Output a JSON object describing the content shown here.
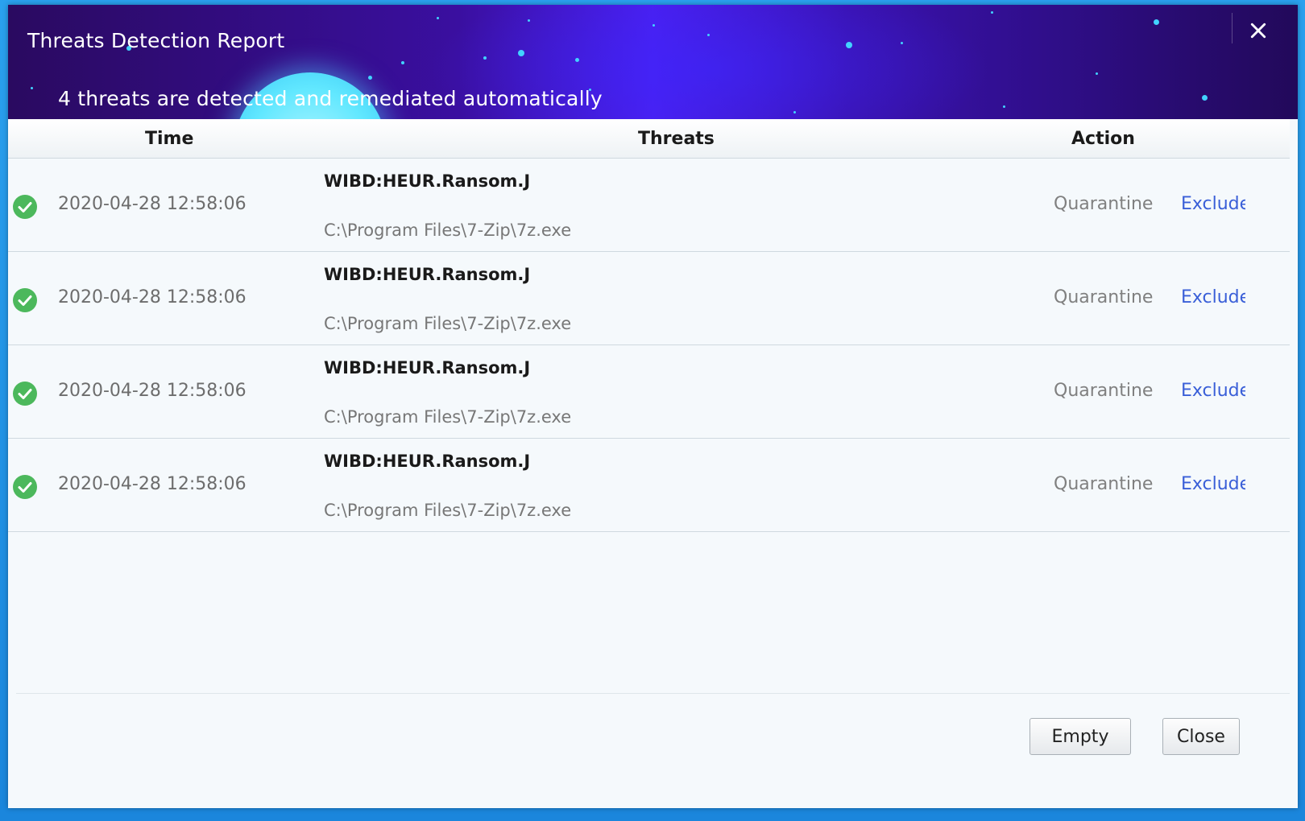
{
  "window": {
    "title": "Threats Detection Report",
    "subtitle": "4 threats are detected and remediated automatically",
    "close_icon": "close-icon"
  },
  "table": {
    "columns": {
      "time": "Time",
      "threats": "Threats",
      "action": "Action"
    },
    "rows": [
      {
        "status_icon": "check-circle-icon",
        "time": "2020-04-28 12:58:06",
        "threat": "WIBD:HEUR.Ransom.J",
        "path": "C:\\Program Files\\7-Zip\\7z.exe",
        "action": "Quarantine",
        "exclude": "Exclude"
      },
      {
        "status_icon": "check-circle-icon",
        "time": "2020-04-28 12:58:06",
        "threat": "WIBD:HEUR.Ransom.J",
        "path": "C:\\Program Files\\7-Zip\\7z.exe",
        "action": "Quarantine",
        "exclude": "Exclude"
      },
      {
        "status_icon": "check-circle-icon",
        "time": "2020-04-28 12:58:06",
        "threat": "WIBD:HEUR.Ransom.J",
        "path": "C:\\Program Files\\7-Zip\\7z.exe",
        "action": "Quarantine",
        "exclude": "Exclude"
      },
      {
        "status_icon": "check-circle-icon",
        "time": "2020-04-28 12:58:06",
        "threat": "WIBD:HEUR.Ransom.J",
        "path": "C:\\Program Files\\7-Zip\\7z.exe",
        "action": "Quarantine",
        "exclude": "Exclude"
      }
    ]
  },
  "footer": {
    "empty_label": "Empty",
    "close_label": "Close"
  },
  "colors": {
    "header_dark": "#2a0a60",
    "header_mid": "#4a1ff0",
    "glow": "#62e8ff",
    "success_green": "#4cb85c",
    "link_blue": "#3a5fd8",
    "desktop_blue": "#1f8fe0"
  }
}
